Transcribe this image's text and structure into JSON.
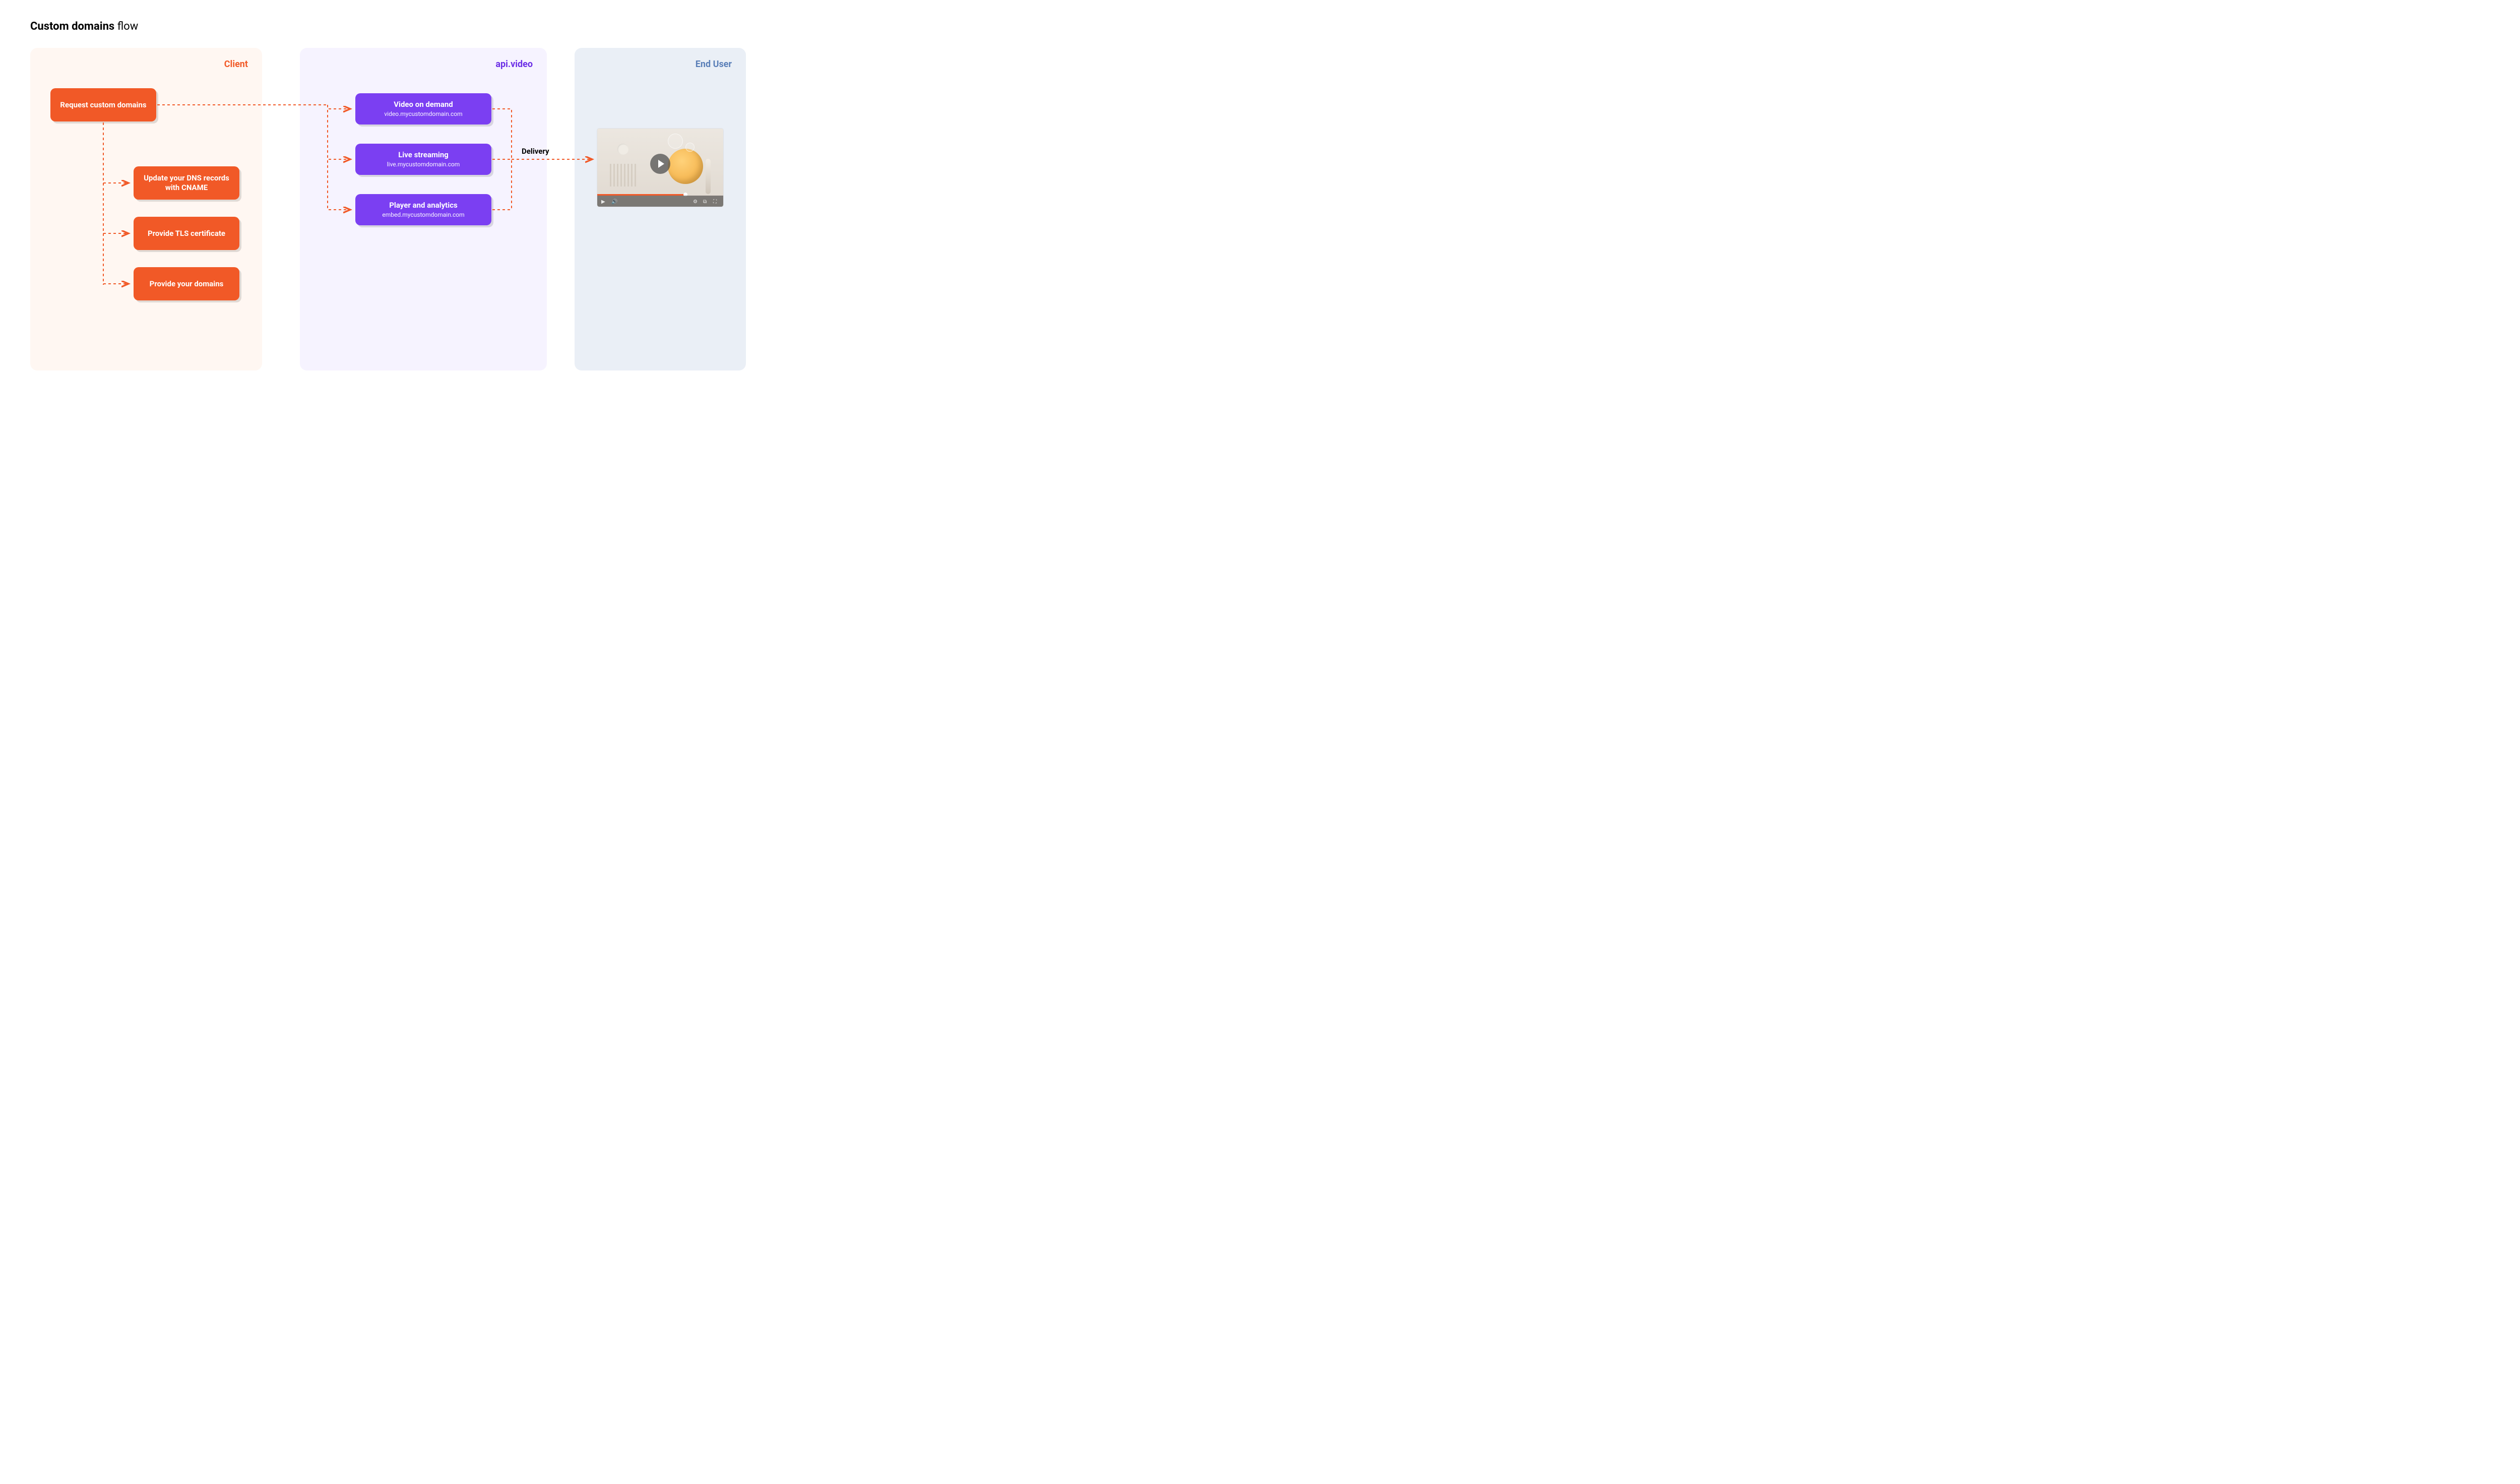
{
  "title": {
    "bold": "Custom domains",
    "light": "flow"
  },
  "panels": {
    "client": {
      "label": "Client"
    },
    "api": {
      "label": "api.video"
    },
    "end": {
      "label": "End User"
    }
  },
  "client_boxes": {
    "request": "Request custom domains",
    "dns": "Update your DNS records with CNAME",
    "tls": "Provide TLS certificate",
    "domains": "Provide your domains"
  },
  "api_boxes": {
    "vod": {
      "title": "Video on demand",
      "sub": "video.mycustomdomain.com"
    },
    "live": {
      "title": "Live streaming",
      "sub": "live.mycustomdomain.com"
    },
    "embed": {
      "title": "Player and analytics",
      "sub": "embed.mycustomdomain.com"
    }
  },
  "delivery_label": "Delivery",
  "colors": {
    "orange": "#f15927",
    "purple": "#7b3ff2",
    "blue": "#5a7fb8"
  }
}
